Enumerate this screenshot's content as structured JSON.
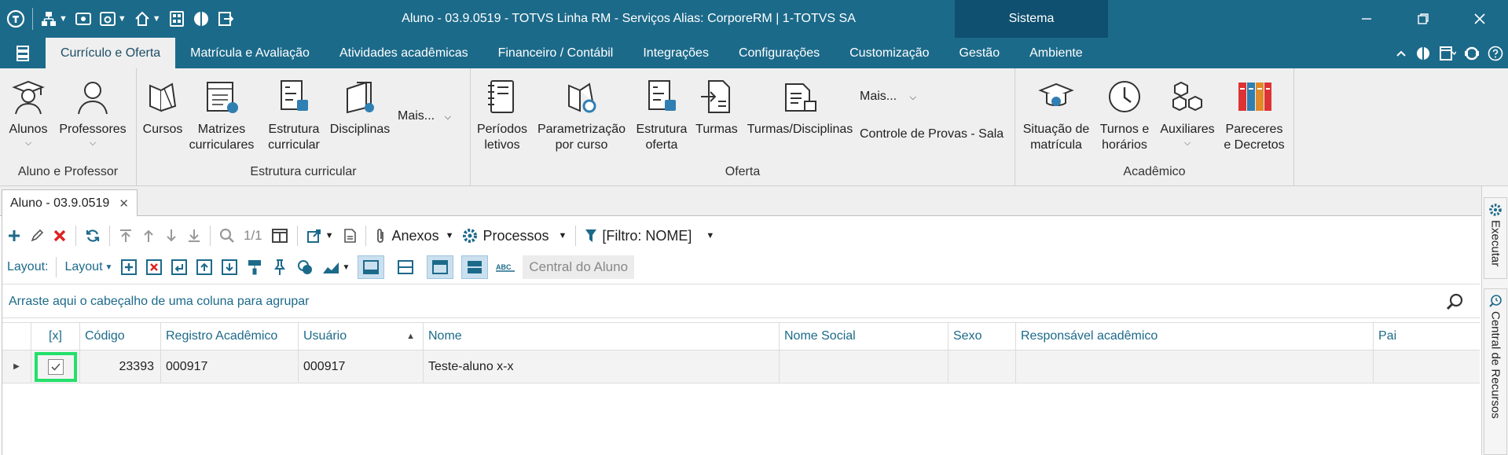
{
  "window": {
    "title": "Aluno - 03.9.0519 - TOTVS Linha RM - Serviços  Alias: CorporeRM | 1-TOTVS SA",
    "context_tab": "Sistema"
  },
  "menu": {
    "tabs": [
      "Currículo e Oferta",
      "Matrícula e Avaliação",
      "Atividades acadêmicas",
      "Financeiro / Contábil",
      "Integrações",
      "Configurações",
      "Customização",
      "Gestão",
      "Ambiente"
    ],
    "active_tab": "Currículo e Oferta"
  },
  "ribbon": {
    "groups": {
      "aluno_professor": {
        "label": "Aluno e Professor",
        "alunos": "Alunos",
        "professores": "Professores"
      },
      "estrutura": {
        "label": "Estrutura curricular",
        "cursos": "Cursos",
        "matrizes_1": "Matrizes",
        "matrizes_2": "curriculares",
        "estrutura_1": "Estrutura",
        "estrutura_2": "curricular",
        "disciplinas": "Disciplinas",
        "mais": "Mais..."
      },
      "oferta": {
        "label": "Oferta",
        "periodos_1": "Períodos",
        "periodos_2": "letivos",
        "param_1": "Parametrização",
        "param_2": "por curso",
        "estoferta_1": "Estrutura",
        "estoferta_2": "oferta",
        "turmas": "Turmas",
        "turmas_disc": "Turmas/Disciplinas",
        "mais": "Mais...",
        "controle": "Controle de Provas - Sala"
      },
      "academico": {
        "label": "Acadêmico",
        "situacao_1": "Situação de",
        "situacao_2": "matrícula",
        "turnos_1": "Turnos e",
        "turnos_2": "horários",
        "auxiliares": "Auxiliares",
        "pareceres_1": "Pareceres",
        "pareceres_2": "e Decretos"
      }
    }
  },
  "document_tab": {
    "label": "Aluno - 03.9.0519"
  },
  "toolbar": {
    "page_indicator": "1/1",
    "anexos": "Anexos",
    "processos": "Processos",
    "filtro": "[Filtro: NOME]",
    "layout_label": "Layout:",
    "layout_dropdown": "Layout",
    "central_aluno": "Central do Aluno"
  },
  "grid": {
    "group_hint": "Arraste aqui o cabeçalho de uma coluna para agrupar",
    "columns": [
      "[x]",
      "Código",
      "Registro Acadêmico",
      "Usuário",
      "Nome",
      "Nome Social",
      "Sexo",
      "Responsável acadêmico",
      "Pai"
    ],
    "sorted_column": "Usuário",
    "rows": [
      {
        "selected": true,
        "codigo": "23393",
        "registro": "000917",
        "usuario": "000917",
        "nome": "Teste-aluno x-x",
        "nome_social": "",
        "sexo": "",
        "responsavel": "",
        "pai": ""
      }
    ]
  },
  "side_panel": {
    "executar": "Executar",
    "central_recursos": "Central de Recursos"
  },
  "colors": {
    "titlebar": "#1c6a8a",
    "context_tab": "#0f4f6f",
    "ribbon_bg": "#efefef",
    "accent_text": "#1c6a8a",
    "selection_highlight": "#22e06a"
  }
}
